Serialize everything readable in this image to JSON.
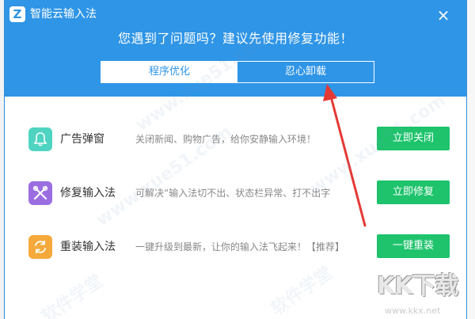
{
  "window": {
    "app_icon_glyph": "Z",
    "title": "智能云输入法",
    "close_glyph": "×"
  },
  "header": {
    "headline": "您遇到了问题吗？建议先使用修复功能！"
  },
  "tabs": [
    {
      "label": "程序优化",
      "active": true
    },
    {
      "label": "忍心卸载",
      "active": false
    }
  ],
  "rows": [
    {
      "icon": "bell-icon",
      "icon_color": "#4fd4c2",
      "title": "广告弹窗",
      "description": "关闭新闻、购物广告，给你安静输入环境！",
      "button": "立即关闭"
    },
    {
      "icon": "tools-icon",
      "icon_color": "#9a6ee0",
      "title": "修复输入法",
      "description": "可解决“输入法切不出、状态栏异常、打不出字",
      "button": "立即修复"
    },
    {
      "icon": "refresh-icon",
      "icon_color": "#f5a93a",
      "title": "重装输入法",
      "description": "一键升级到最新，让你的输入法飞起来！【推荐】",
      "button": "一键重装"
    }
  ],
  "watermark": {
    "text": "www.xue51.com",
    "brand": "软件学堂"
  },
  "site_logo": {
    "text": "KK下载",
    "url": "www.kkx.net"
  },
  "colors": {
    "header_blue": "#2f95e6",
    "button_green": "#1ec36c",
    "arrow_red": "#e53935"
  }
}
